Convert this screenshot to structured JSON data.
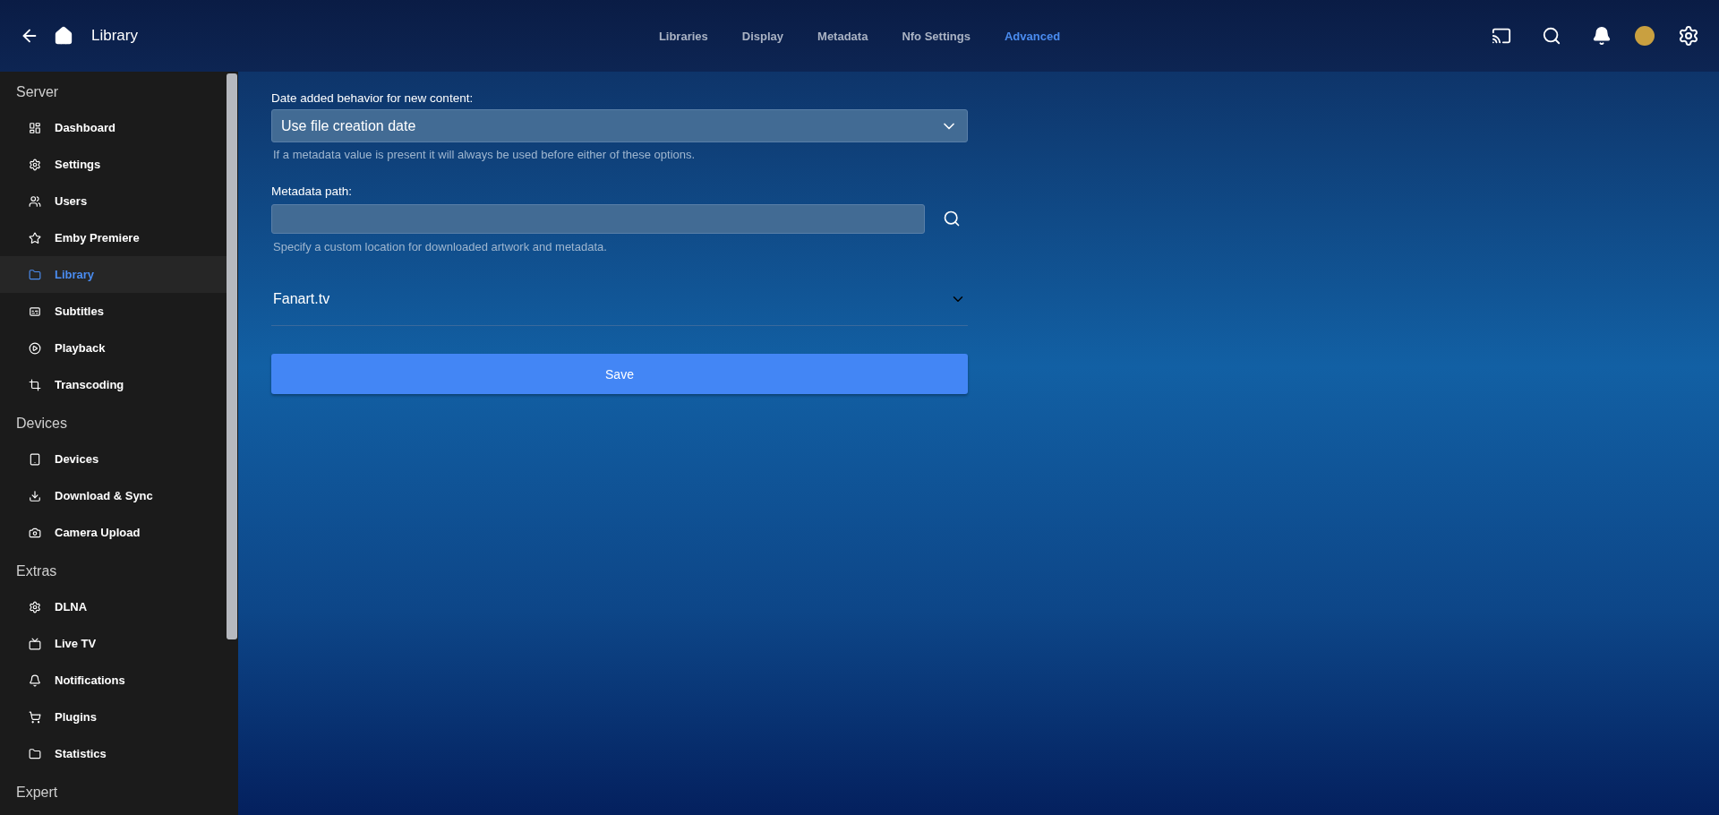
{
  "header": {
    "title": "Library",
    "tabs": [
      {
        "label": "Libraries",
        "selected": false
      },
      {
        "label": "Display",
        "selected": false
      },
      {
        "label": "Metadata",
        "selected": false
      },
      {
        "label": "Nfo Settings",
        "selected": false
      },
      {
        "label": "Advanced",
        "selected": true
      }
    ]
  },
  "sidebar": {
    "sections": [
      {
        "title": "Server",
        "items": [
          {
            "label": "Dashboard",
            "selected": false
          },
          {
            "label": "Settings",
            "selected": false
          },
          {
            "label": "Users",
            "selected": false
          },
          {
            "label": "Emby Premiere",
            "selected": false
          },
          {
            "label": "Library",
            "selected": true
          },
          {
            "label": "Subtitles",
            "selected": false
          },
          {
            "label": "Playback",
            "selected": false
          },
          {
            "label": "Transcoding",
            "selected": false
          }
        ]
      },
      {
        "title": "Devices",
        "items": [
          {
            "label": "Devices",
            "selected": false
          },
          {
            "label": "Download & Sync",
            "selected": false
          },
          {
            "label": "Camera Upload",
            "selected": false
          }
        ]
      },
      {
        "title": "Extras",
        "items": [
          {
            "label": "DLNA",
            "selected": false
          },
          {
            "label": "Live TV",
            "selected": false
          },
          {
            "label": "Notifications",
            "selected": false
          },
          {
            "label": "Plugins",
            "selected": false
          },
          {
            "label": "Statistics",
            "selected": false
          }
        ]
      },
      {
        "title": "Expert"
      }
    ]
  },
  "form": {
    "date_added": {
      "label": "Date added behavior for new content:",
      "value": "Use file creation date",
      "help": "If a metadata value is present it will always be used before either of these options."
    },
    "metadata_path": {
      "label": "Metadata path:",
      "help": "Specify a custom location for downloaded artwork and metadata."
    },
    "section": {
      "title": "Fanart.tv",
      "expanded": false
    },
    "save": "Save"
  }
}
